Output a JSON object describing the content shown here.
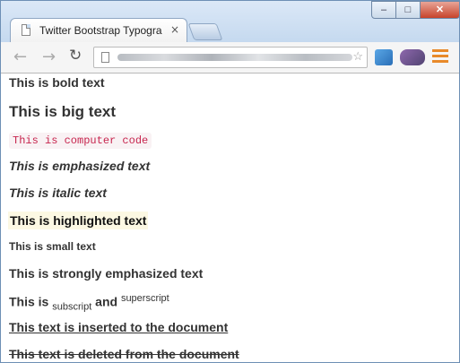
{
  "browser": {
    "tab_title": "Twitter Bootstrap Typogra",
    "tab_close": "×",
    "window_controls": {
      "minimize": "‒",
      "maximize": "□",
      "close": "✕"
    },
    "nav": {
      "back": "←",
      "forward": "→",
      "reload": "↻"
    },
    "bookmark_star": "☆"
  },
  "page": {
    "bold_text": "This is bold text",
    "big_text": "This is big text",
    "code_text": "This is computer code",
    "emphasized_text": "This is emphasized text",
    "italic_text": "This is italic text",
    "highlighted_text": "This is highlighted text",
    "small_text": "This is small text",
    "strong_text": "This is strongly emphasized text",
    "subsup": {
      "prefix": "This is ",
      "sub": "subscript",
      "and": " and ",
      "sup": "superscript"
    },
    "inserted_text": "This text is inserted to the document",
    "deleted_text": "This text is deleted from the document"
  },
  "colors": {
    "code_fg": "#c7254e",
    "code_bg": "#f9f2f4",
    "mark_bg": "#fcf8e3",
    "text": "#333333"
  }
}
